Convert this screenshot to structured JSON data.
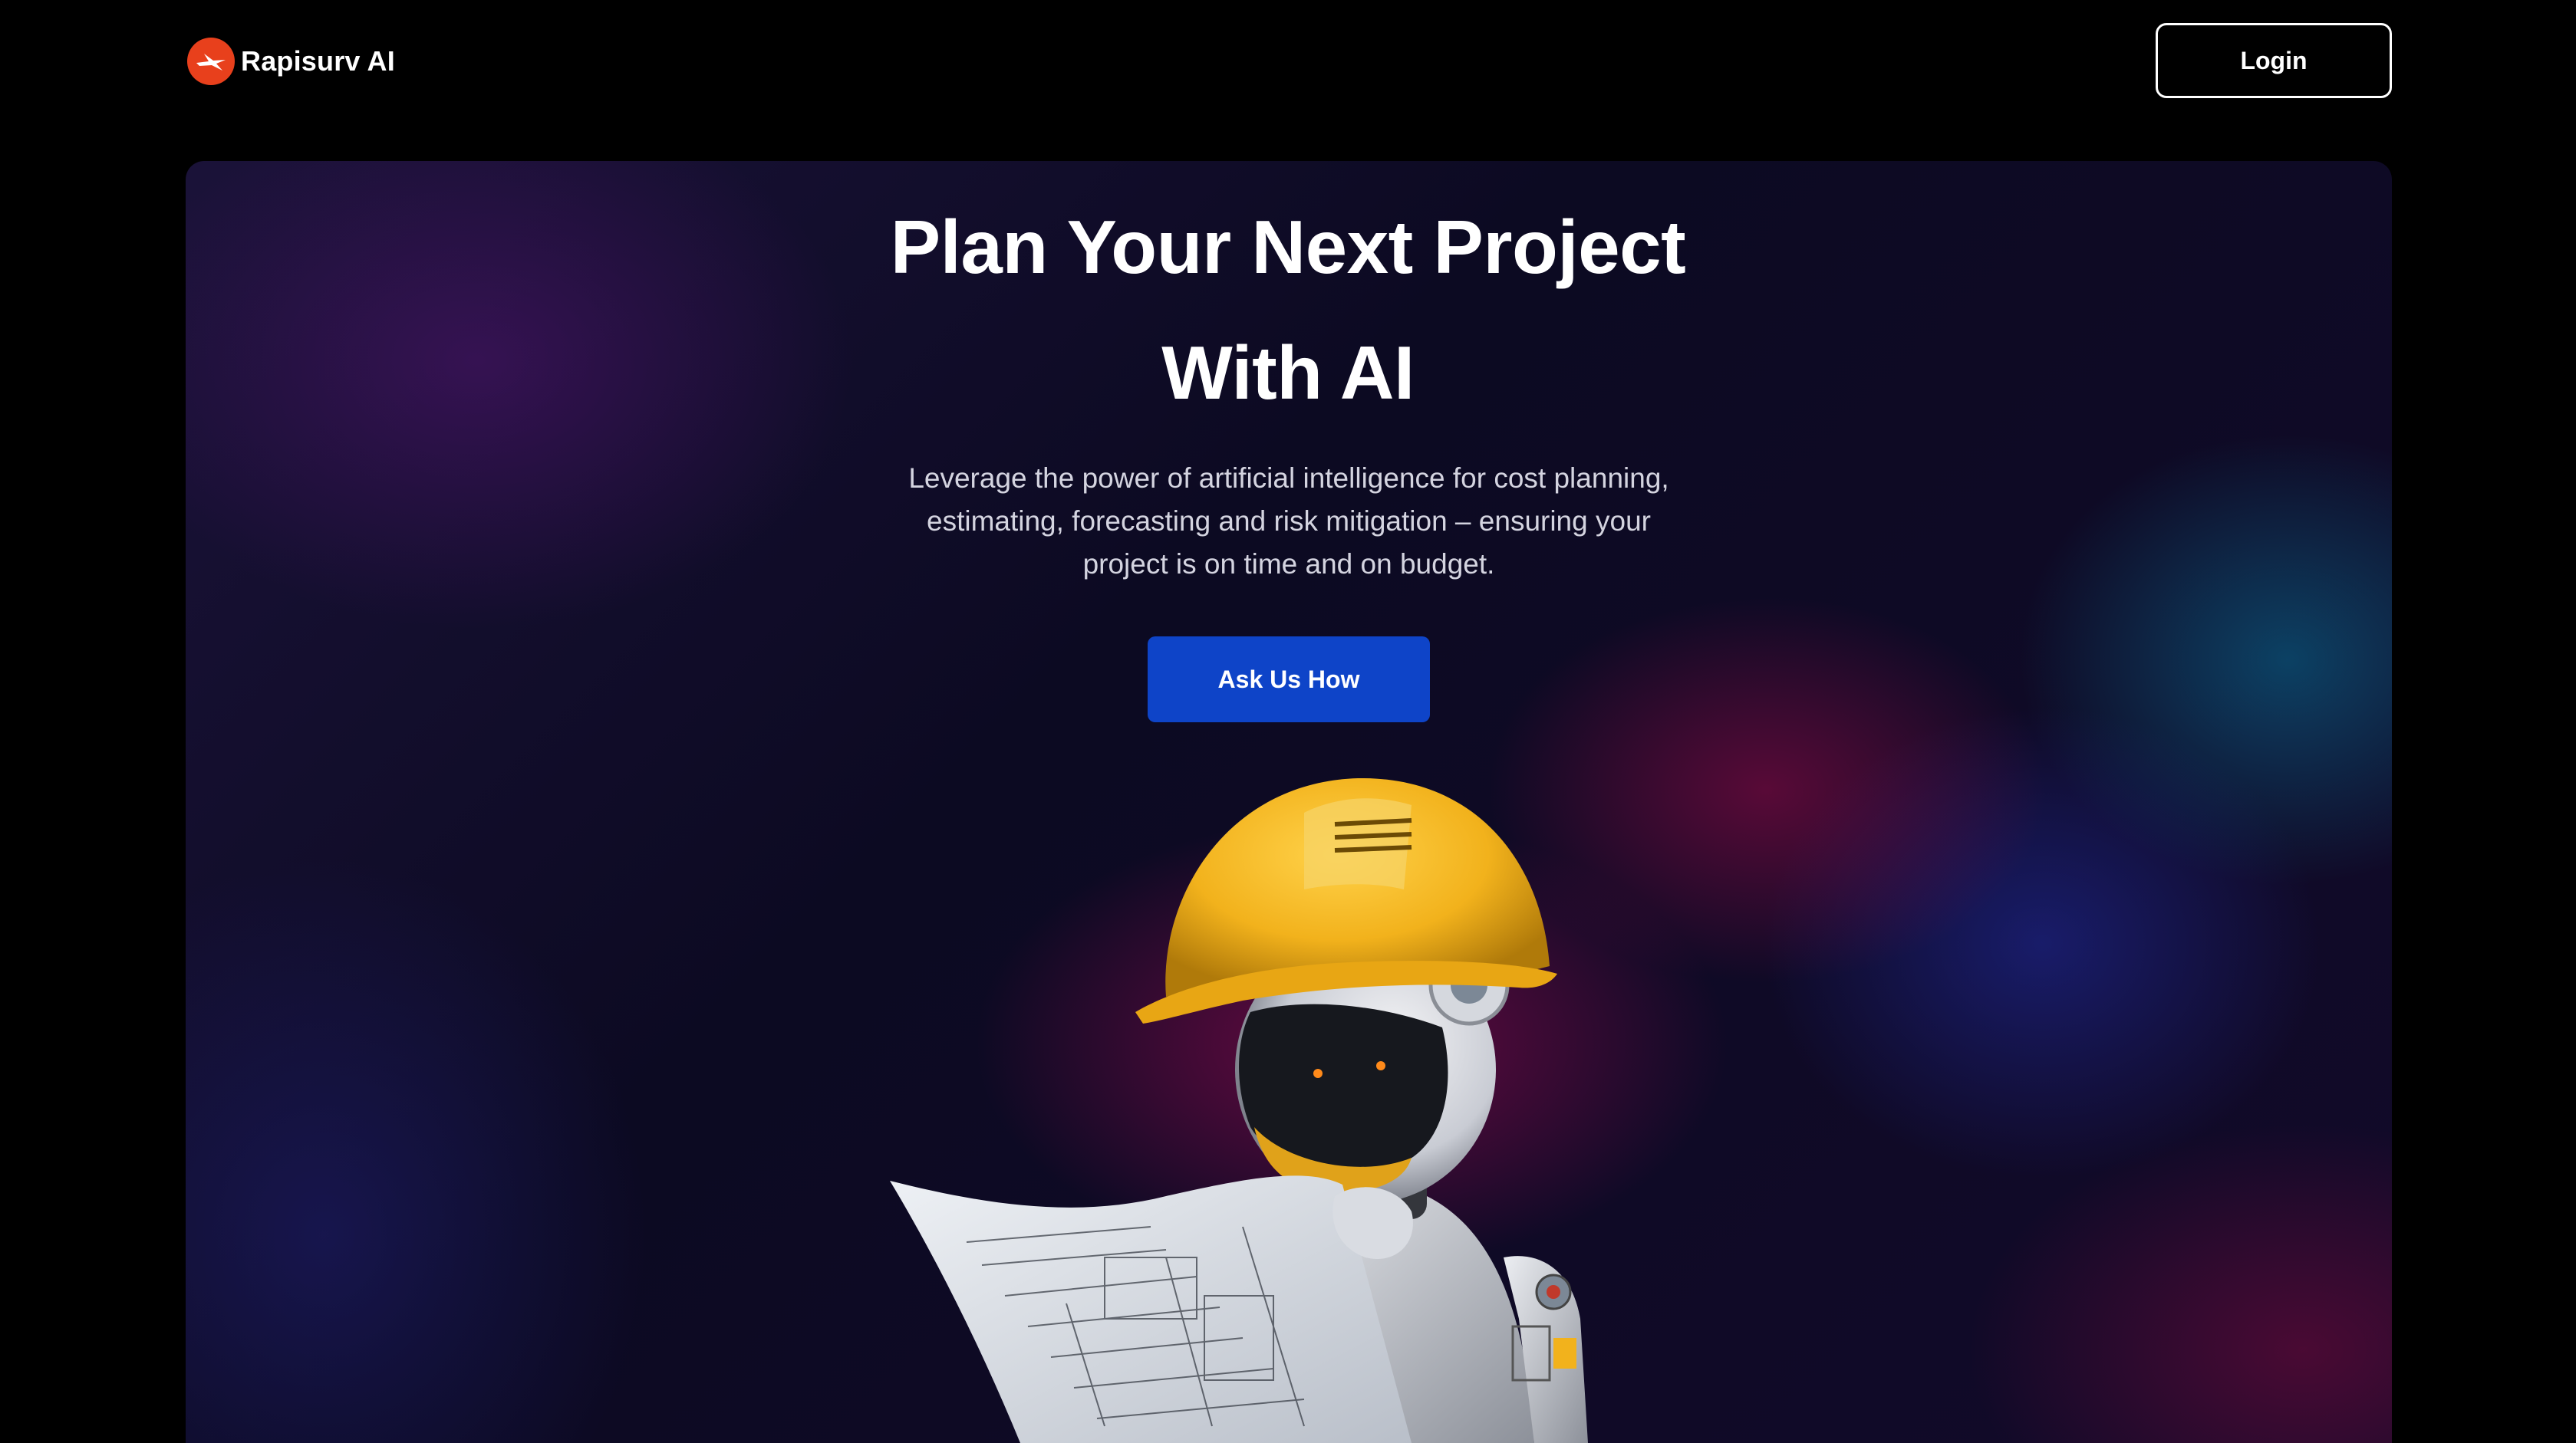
{
  "header": {
    "brand": "Rapisurv AI",
    "login_label": "Login"
  },
  "hero": {
    "title_line1": "Plan Your Next Project",
    "title_line2": "With AI",
    "subtitle": "Leverage the power of artificial intelligence for cost planning, estimating, forecasting and risk mitigation – ensuring your project is on time and on budget.",
    "cta_label": "Ask Us How"
  },
  "colors": {
    "page_background": "#000000",
    "brand_mark": "#e8401c",
    "cta_background": "#0e44c8",
    "hard_hat": "#f2b21c"
  },
  "icons": {
    "logo": "rapisurv-logo-icon",
    "illustration": "robot-with-blueprint"
  }
}
